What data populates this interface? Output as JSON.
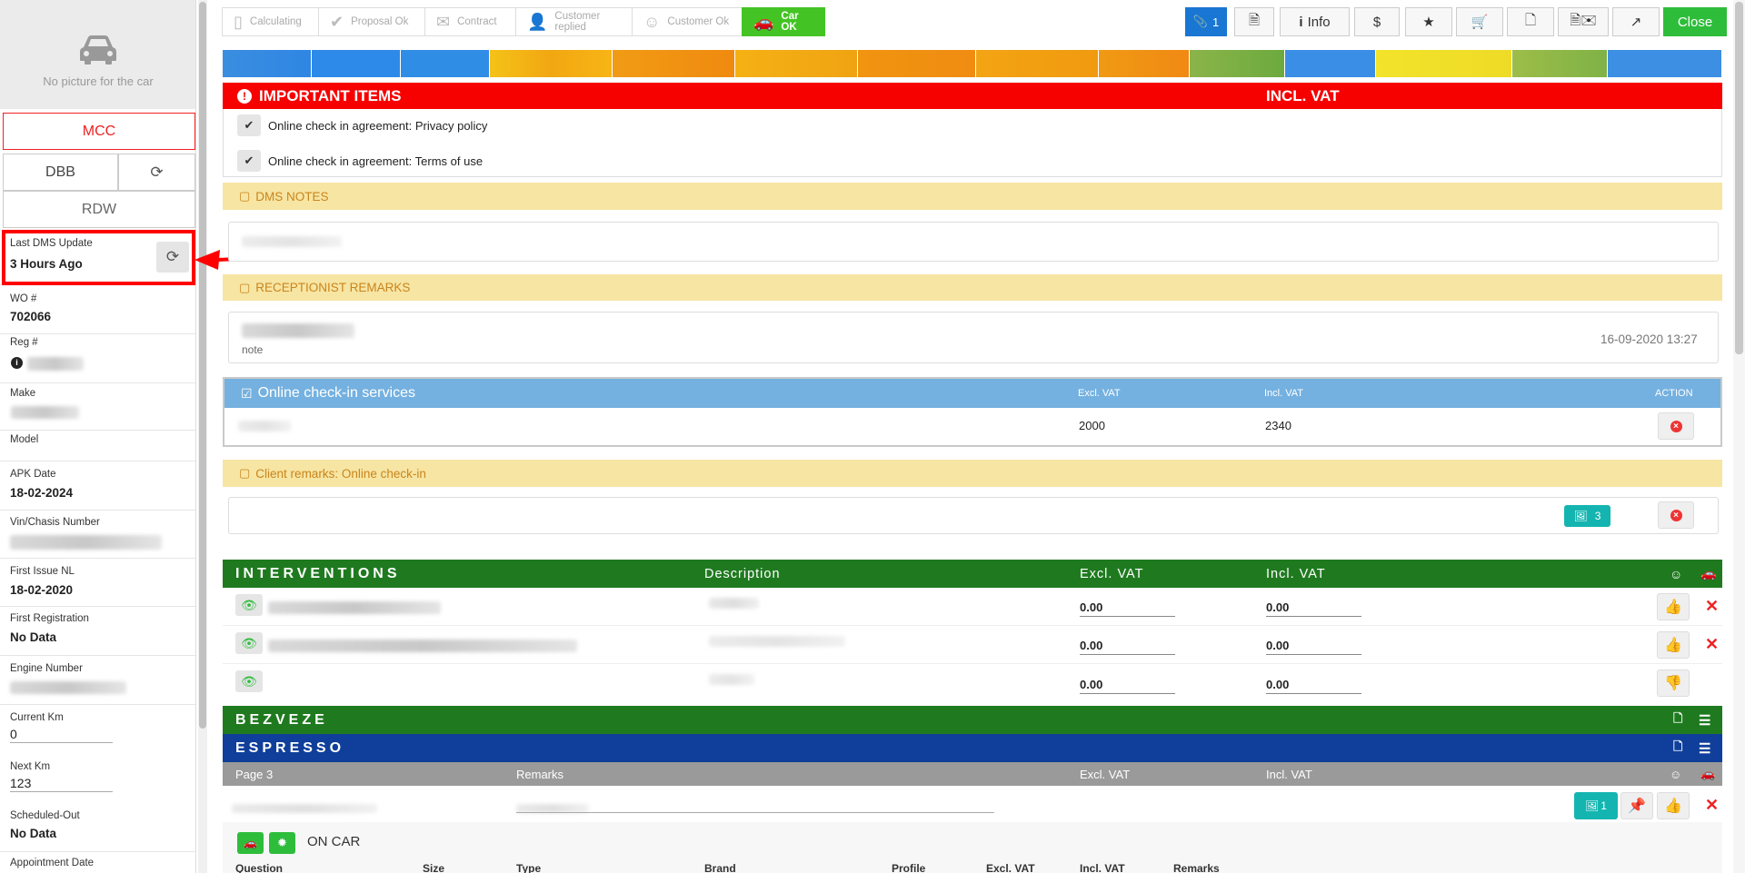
{
  "sidebar": {
    "no_picture": "No picture for the car",
    "mcc": "MCC",
    "dbb": "DBB",
    "rdw": "RDW",
    "last_dms_label": "Last DMS Update",
    "last_dms_value": "3 Hours Ago",
    "wo_label": "WO #",
    "wo_value": "702066",
    "reg_label": "Reg #",
    "make_label": "Make",
    "model_label": "Model",
    "apk_label": "APK Date",
    "apk_value": "18-02-2024",
    "vin_label": "Vin/Chasis Number",
    "first_issue_label": "First Issue NL",
    "first_issue_value": "18-02-2020",
    "first_reg_label": "First Registration",
    "first_reg_value": "No Data",
    "engine_label": "Engine Number",
    "current_km_label": "Current Km",
    "current_km_value": "0",
    "next_km_label": "Next Km",
    "next_km_value": "123",
    "scheduled_label": "Scheduled-Out",
    "scheduled_value": "No Data",
    "appointment_label": "Appointment Date"
  },
  "steps": [
    {
      "label": "Calculating",
      "icon": "file-icon"
    },
    {
      "label": "Proposal Ok",
      "icon": "check-icon"
    },
    {
      "label": "Contract",
      "icon": "envelope-icon"
    },
    {
      "label": "Customer replied",
      "icon": "user-icon"
    },
    {
      "label": "Customer Ok",
      "icon": "smile-icon"
    },
    {
      "label": "Car OK",
      "icon": "car-icon"
    }
  ],
  "toolbar": {
    "attach_count": "1",
    "info_label": "Info",
    "dollar": "$",
    "close_label": "Close"
  },
  "important": {
    "title": "IMPORTANT ITEMS",
    "incl_vat": "INCL. VAT",
    "privacy": "Online check in agreement: Privacy policy",
    "terms": "Online check in agreement: Terms of use"
  },
  "dms_notes": {
    "title": "DMS NOTES"
  },
  "receptionist": {
    "title": "RECEPTIONIST REMARKS",
    "note": "note",
    "timestamp": "16-09-2020 13:27"
  },
  "services": {
    "title": "Online check-in services",
    "excl_vat": "Excl. VAT",
    "incl_vat": "Incl. VAT",
    "action": "ACTION",
    "row_excl": "2000",
    "row_incl": "2340"
  },
  "client_remarks": {
    "title": "Client remarks: Online check-in",
    "photo_count": "3"
  },
  "interventions": {
    "title": "INTERVENTIONS",
    "description": "Description",
    "excl_vat": "Excl. VAT",
    "incl_vat": "Incl. VAT",
    "rows": [
      {
        "excl": "0.00",
        "incl": "0.00"
      },
      {
        "excl": "0.00",
        "incl": "0.00"
      },
      {
        "excl": "0.00",
        "incl": "0.00"
      }
    ]
  },
  "bezveze": {
    "title": "BEZVEZE"
  },
  "espresso": {
    "title": "ESPRESSO",
    "page": "Page 3",
    "remarks": "Remarks",
    "excl_vat": "Excl. VAT",
    "incl_vat": "Incl. VAT",
    "photo_count": "1"
  },
  "on_car": {
    "label": "ON CAR",
    "columns": [
      "Question",
      "Size",
      "Type",
      "Brand",
      "Profile",
      "Excl. VAT",
      "Incl. VAT",
      "Remarks"
    ]
  },
  "colors": {
    "red": "#f60000",
    "green": "#1f7a1f",
    "navy": "#0f3f9a",
    "accent_green": "#2ebd3b",
    "blue": "#1976d2"
  }
}
